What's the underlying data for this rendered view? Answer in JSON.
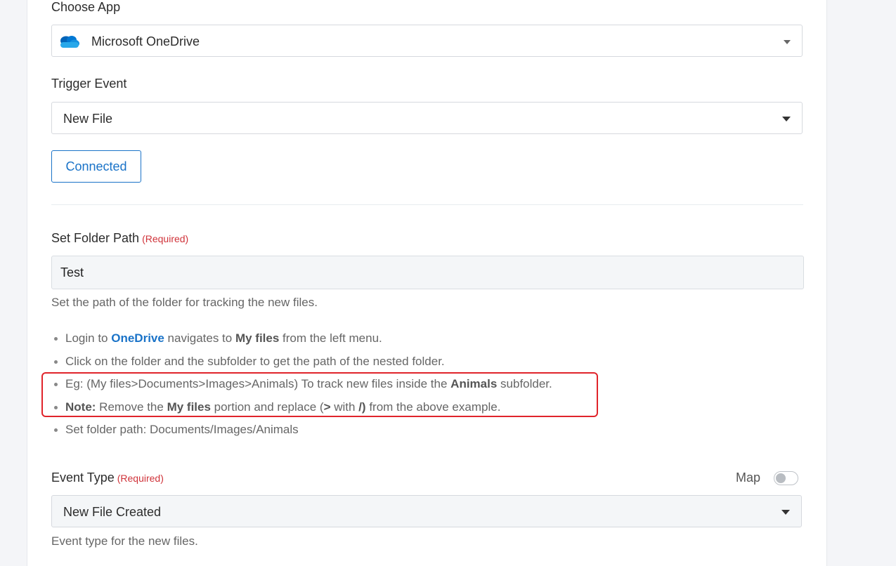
{
  "choose_app": {
    "label": "Choose App",
    "value": "Microsoft OneDrive"
  },
  "trigger_event": {
    "label": "Trigger Event",
    "value": "New File"
  },
  "connection": {
    "button_label": "Connected"
  },
  "folder_path": {
    "label": "Set Folder Path",
    "required": "(Required)",
    "value": "Test",
    "help": "Set the path of the folder for tracking the new files.",
    "bullets": {
      "b1": {
        "t1": "Login to ",
        "link": "OneDrive",
        "t2": " navigates to ",
        "bold": "My files",
        "t3": " from the left menu."
      },
      "b2": {
        "t1": "Click on the folder and the subfolder to get the path of the nested folder."
      },
      "b3": {
        "t1": "Eg: (My files>Documents>Images>Animals) To track new files inside the ",
        "bold": "Animals",
        "t2": " subfolder."
      },
      "b4": {
        "note": "Note:",
        "t1": " Remove the ",
        "bold1": "My files",
        "t2": " portion and replace (",
        "bold2": ">",
        "t3": " with ",
        "bold3": "/)",
        "t4": " from the above example."
      },
      "b5": {
        "t1": "Set folder path: Documents/Images/Animals"
      }
    }
  },
  "event_type": {
    "label": "Event Type",
    "required": "(Required)",
    "map_label": "Map",
    "map_enabled": false,
    "value": "New File Created",
    "help": "Event type for the new files."
  },
  "colors": {
    "accent": "#1a73c8",
    "required": "#d0333a",
    "highlight": "#e0242b"
  }
}
